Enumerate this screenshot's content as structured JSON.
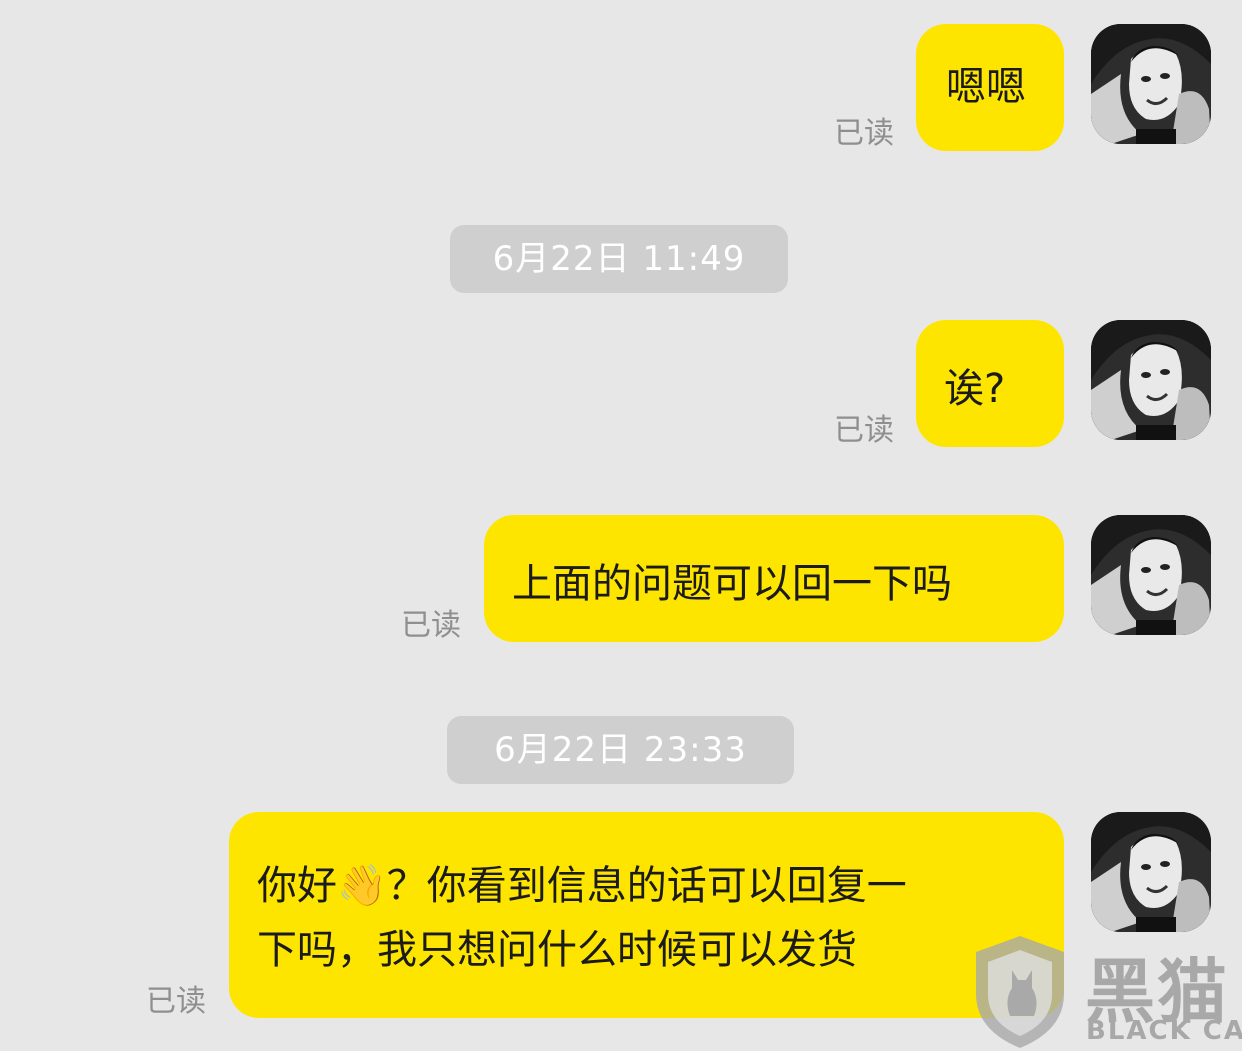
{
  "messages": [
    {
      "text": "嗯嗯",
      "status": "已读"
    },
    {
      "text": "诶?",
      "status": "已读"
    },
    {
      "text": "上面的问题可以回一下吗",
      "status": "已读"
    },
    {
      "line1": "你好👋？你看到信息的话可以回复一",
      "line2": "下吗，我只想问什么时候可以发货",
      "status": "已读"
    }
  ],
  "timestamps": [
    "6月22日 11:49",
    "6月22日 23:33"
  ],
  "watermark": {
    "cn": "黑猫",
    "en": "BLACK CAT"
  },
  "colors": {
    "bubble": "#fee500",
    "background": "#e7e7e7",
    "timestamp_bg": "#cfcfcf",
    "read_status": "#8f8f8f"
  },
  "icons": [
    "avatar-image",
    "black-cat-logo-icon"
  ]
}
